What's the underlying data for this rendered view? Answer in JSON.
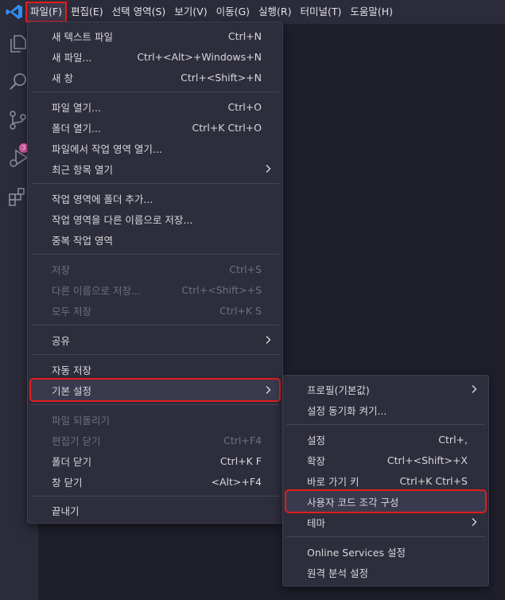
{
  "menubar": {
    "items": [
      {
        "label": "파일(F)"
      },
      {
        "label": "편집(E)"
      },
      {
        "label": "선택 영역(S)"
      },
      {
        "label": "보기(V)"
      },
      {
        "label": "이동(G)"
      },
      {
        "label": "실행(R)"
      },
      {
        "label": "터미널(T)"
      },
      {
        "label": "도움말(H)"
      }
    ]
  },
  "activitybar": {
    "icons": [
      "explorer-icon",
      "search-icon",
      "source-control-icon",
      "run-debug-icon",
      "extensions-icon"
    ],
    "badge": "3"
  },
  "file_menu": {
    "items": [
      {
        "label": "새 텍스트 파일",
        "shortcut": "Ctrl+N"
      },
      {
        "label": "새 파일...",
        "shortcut": "Ctrl+<Alt>+Windows+N"
      },
      {
        "label": "새 창",
        "shortcut": "Ctrl+<Shift>+N"
      },
      {
        "label": "파일 열기...",
        "shortcut": "Ctrl+O"
      },
      {
        "label": "폴더 열기...",
        "shortcut": "Ctrl+K Ctrl+O"
      },
      {
        "label": "파일에서 작업 영역 열기...",
        "shortcut": ""
      },
      {
        "label": "최근 항목 열기",
        "shortcut": ""
      },
      {
        "label": "작업 영역에 폴더 추가...",
        "shortcut": ""
      },
      {
        "label": "작업 영역을 다른 이름으로 저장...",
        "shortcut": ""
      },
      {
        "label": "중복 작업 영역",
        "shortcut": ""
      },
      {
        "label": "저장",
        "shortcut": "Ctrl+S"
      },
      {
        "label": "다른 이름으로 저장...",
        "shortcut": "Ctrl+<Shift>+S"
      },
      {
        "label": "모두 저장",
        "shortcut": "Ctrl+K S"
      },
      {
        "label": "공유",
        "shortcut": ""
      },
      {
        "label": "자동 저장",
        "shortcut": ""
      },
      {
        "label": "기본 설정",
        "shortcut": ""
      },
      {
        "label": "파일 되돌리기",
        "shortcut": ""
      },
      {
        "label": "편집기 닫기",
        "shortcut": "Ctrl+F4"
      },
      {
        "label": "폴더 닫기",
        "shortcut": "Ctrl+K F"
      },
      {
        "label": "창 닫기",
        "shortcut": "<Alt>+F4"
      },
      {
        "label": "끝내기",
        "shortcut": ""
      }
    ]
  },
  "preferences_menu": {
    "items": [
      {
        "label": "프로필(기본값)",
        "shortcut": ""
      },
      {
        "label": "설정 동기화 켜기...",
        "shortcut": ""
      },
      {
        "label": "설정",
        "shortcut": "Ctrl+,"
      },
      {
        "label": "확장",
        "shortcut": "Ctrl+<Shift>+X"
      },
      {
        "label": "바로 가기 키",
        "shortcut": "Ctrl+K Ctrl+S"
      },
      {
        "label": "사용자 코드 조각 구성",
        "shortcut": ""
      },
      {
        "label": "테마",
        "shortcut": ""
      },
      {
        "label": "Online Services 설정",
        "shortcut": ""
      },
      {
        "label": "원격 분석 설정",
        "shortcut": ""
      }
    ]
  },
  "colors": {
    "highlight": "#e01e1e",
    "brand": "#2f8ff0",
    "badge": "#e05aa8"
  }
}
